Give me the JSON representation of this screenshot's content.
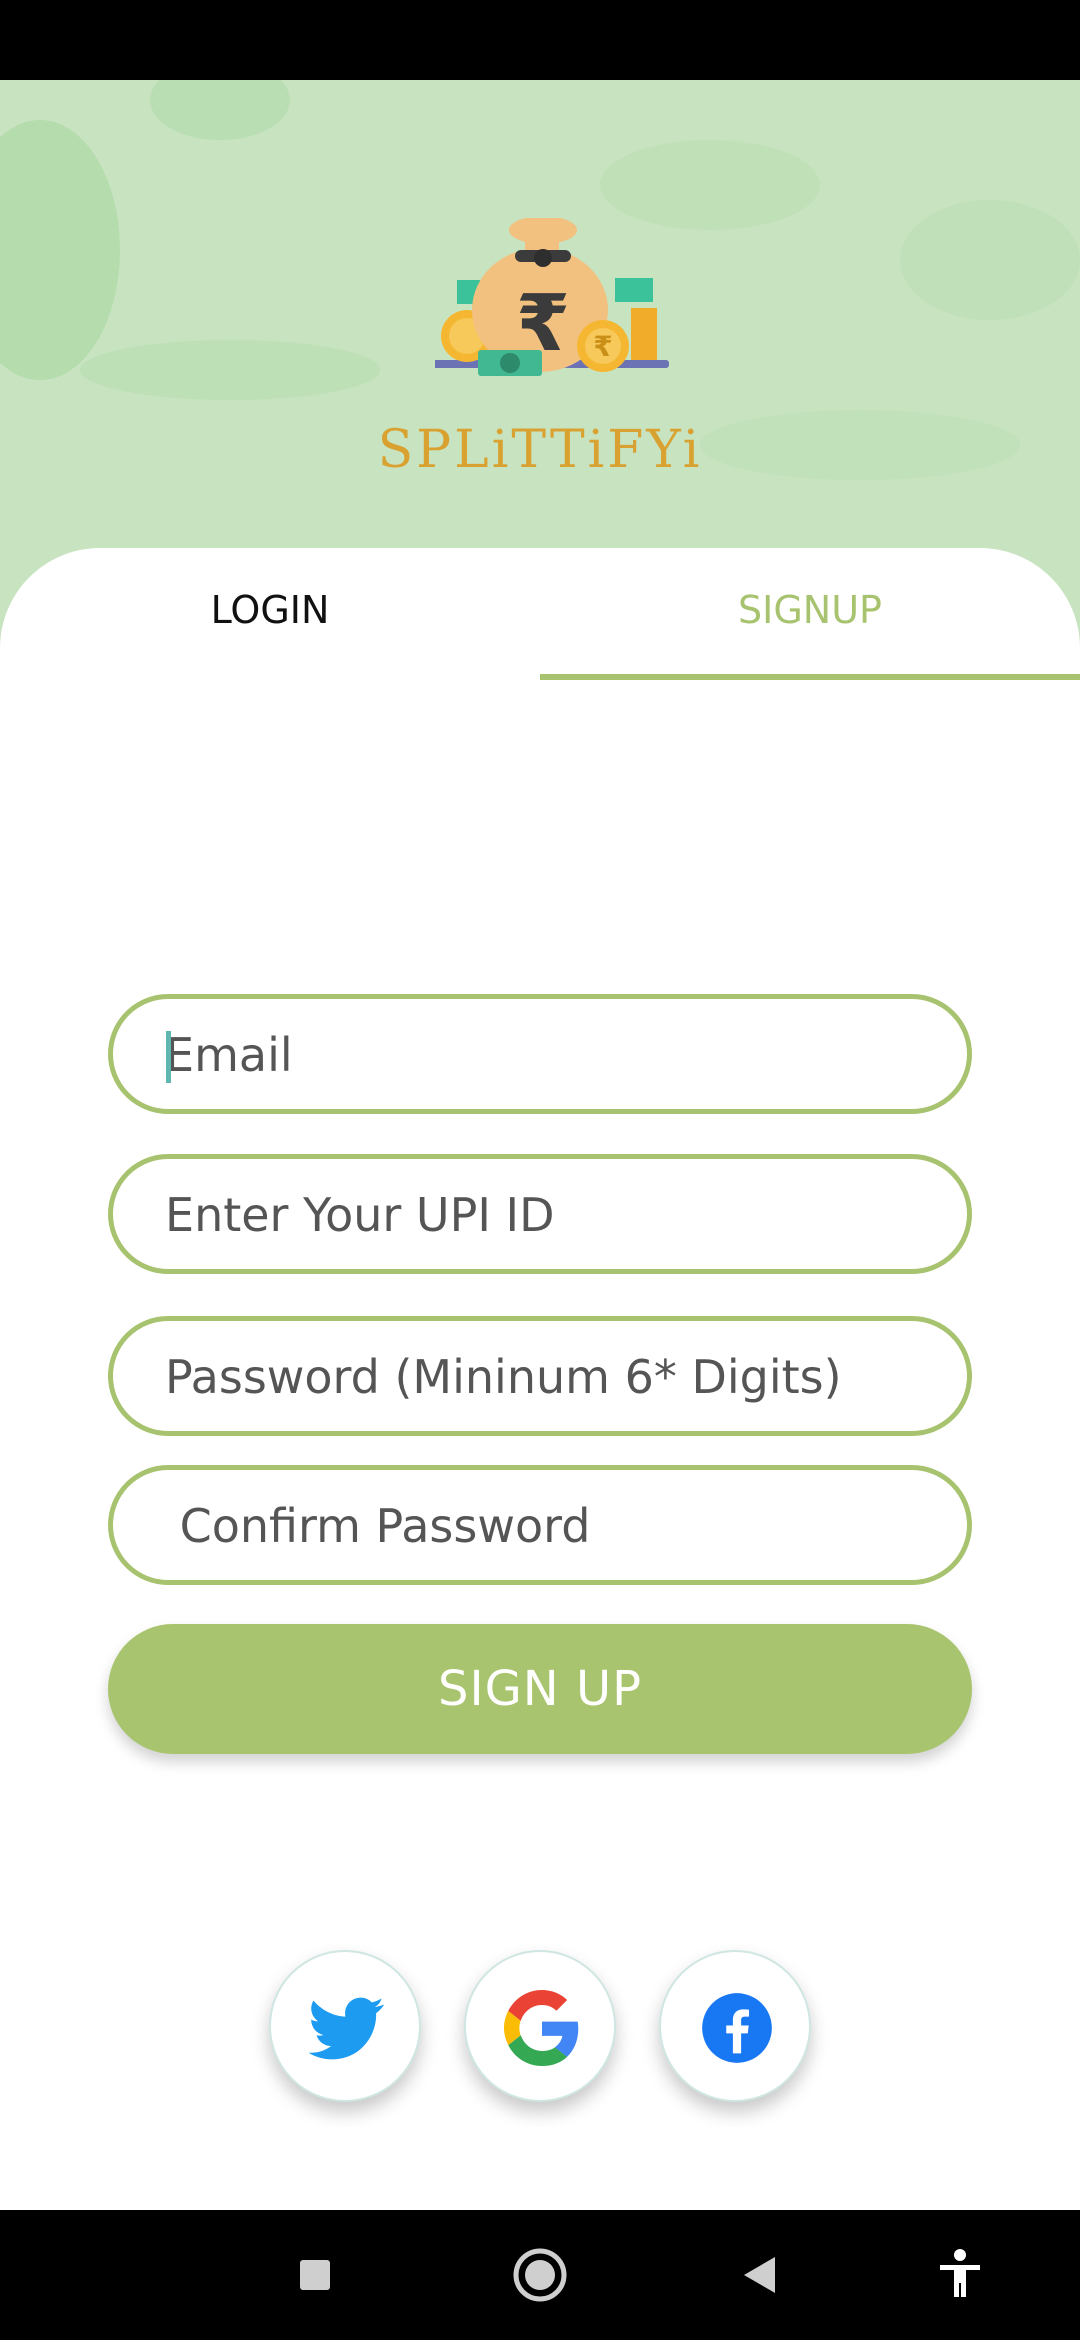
{
  "app": {
    "brand_name": "SPLiTTiFYi"
  },
  "tabs": [
    {
      "label": "LOGIN",
      "active": false
    },
    {
      "label": "SIGNUP",
      "active": true
    }
  ],
  "form": {
    "email_placeholder": "Email",
    "upi_placeholder": "Enter Your UPI ID",
    "password_placeholder": "Password (Mininum 6* Digits)",
    "confirm_placeholder": " Confirm Password",
    "submit_label": "SIGN UP"
  },
  "social": [
    {
      "icon": "twitter-icon"
    },
    {
      "icon": "google-icon"
    },
    {
      "icon": "facebook-icon"
    }
  ],
  "colors": {
    "accent": "#a8c36f",
    "hero_bg": "#c7e3c0",
    "brand": "#d9a230"
  },
  "nav": [
    "recents-icon",
    "home-icon",
    "back-icon",
    "accessibility-icon"
  ]
}
